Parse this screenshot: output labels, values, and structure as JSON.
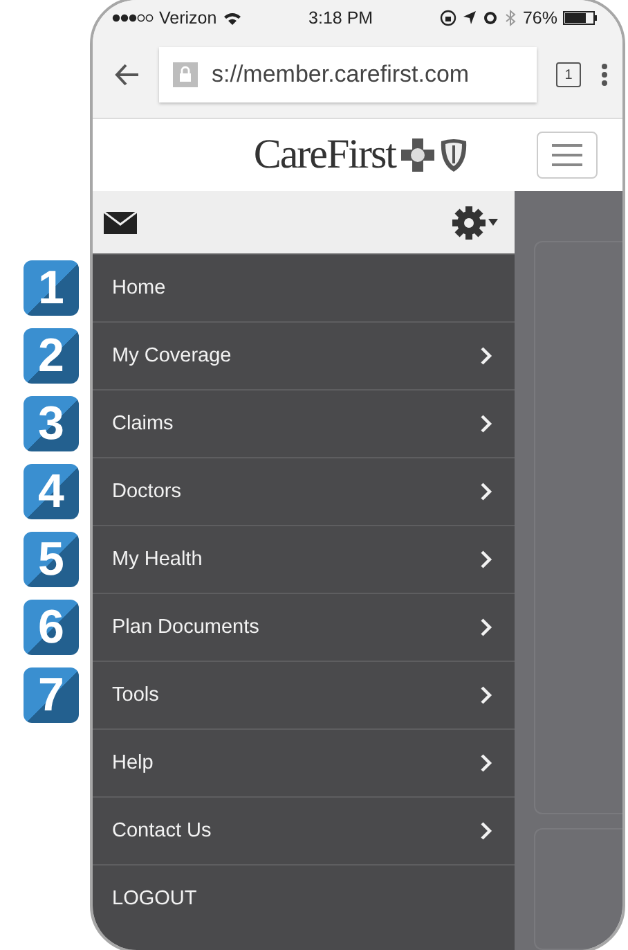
{
  "status_bar": {
    "carrier": "Verizon",
    "time": "3:18 PM",
    "battery": "76%"
  },
  "browser": {
    "url": "s://member.carefirst.com",
    "tab_count": "1"
  },
  "header": {
    "logo": "CareFirst"
  },
  "menu": {
    "items": [
      {
        "label": "Home",
        "submenu": false
      },
      {
        "label": "My Coverage",
        "submenu": true
      },
      {
        "label": "Claims",
        "submenu": true
      },
      {
        "label": "Doctors",
        "submenu": true
      },
      {
        "label": "My Health",
        "submenu": true
      },
      {
        "label": "Plan Documents",
        "submenu": true
      },
      {
        "label": "Tools",
        "submenu": true
      },
      {
        "label": "Help",
        "submenu": true
      },
      {
        "label": "Contact Us",
        "submenu": true
      },
      {
        "label": "LOGOUT",
        "submenu": false
      }
    ]
  },
  "callouts": [
    "1",
    "2",
    "3",
    "4",
    "5",
    "6",
    "7"
  ]
}
